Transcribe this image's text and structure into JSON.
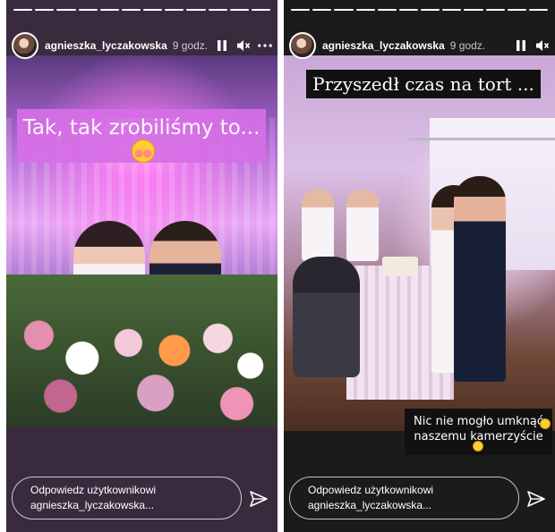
{
  "stories": [
    {
      "username": "agnieszka_lyczakowska",
      "time": "9 godz.",
      "caption": "Tak, tak zrobiliśmy to...",
      "caption_emoji": "smiling-face-with-hearts-icon",
      "reply_placeholder": "Odpowiedz użytkownikowi agnieszka_lyczakowska...",
      "progress_segments": 12,
      "progress_active": 12
    },
    {
      "username": "agnieszka_lyczakowska",
      "time": "9 godz.",
      "caption": "Przyszedł czas na tort ...",
      "caption2_line1": "Nic nie mogło umknąć",
      "caption2_line2": "naszemu kamerzyście",
      "reply_placeholder": "Odpowiedz użytkownikowi agnieszka_lyczakowska...",
      "progress_segments": 12,
      "progress_active": 12
    }
  ],
  "icons": {
    "pause": "pause-icon",
    "mute": "mute-icon",
    "more": "more-options-icon",
    "send": "send-icon"
  },
  "colors": {
    "caption_pink_bg": "#d66fe6",
    "caption_black_bg": "#111111",
    "text": "#ffffff"
  }
}
